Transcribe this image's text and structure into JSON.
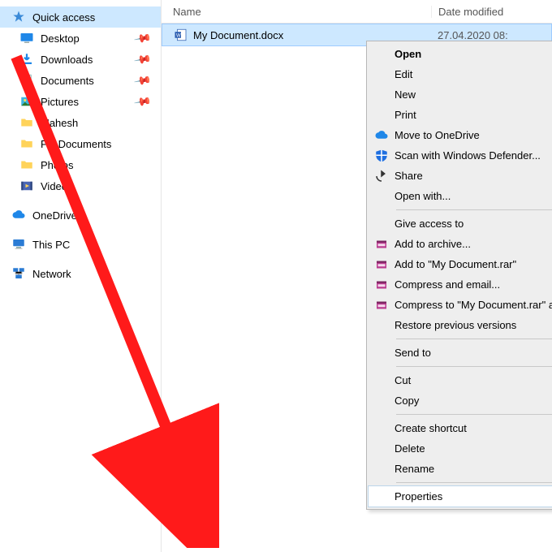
{
  "columns": {
    "name": "Name",
    "date": "Date modified"
  },
  "file": {
    "name": "My Document.docx",
    "date": "27.04.2020 08:"
  },
  "sidebar": {
    "quick_access": "Quick access",
    "items": [
      {
        "label": "Desktop"
      },
      {
        "label": "Downloads"
      },
      {
        "label": "Documents"
      },
      {
        "label": "Pictures"
      },
      {
        "label": "Mahesh"
      },
      {
        "label": "PC Documents"
      },
      {
        "label": "Photos"
      },
      {
        "label": "Videos"
      }
    ],
    "onedrive": "OneDrive",
    "thispc": "This PC",
    "network": "Network"
  },
  "menu": {
    "open": "Open",
    "edit": "Edit",
    "new": "New",
    "print": "Print",
    "onedrive": "Move to OneDrive",
    "defender": "Scan with Windows Defender...",
    "share": "Share",
    "openwith": "Open with...",
    "giveaccess": "Give access to",
    "addarchive": "Add to archive...",
    "addrar": "Add to \"My Document.rar\"",
    "compressemail": "Compress and email...",
    "compressraremail": "Compress to \"My Document.rar\" and email",
    "restore": "Restore previous versions",
    "sendto": "Send to",
    "cut": "Cut",
    "copy": "Copy",
    "createshortcut": "Create shortcut",
    "delete": "Delete",
    "rename": "Rename",
    "properties": "Properties"
  }
}
